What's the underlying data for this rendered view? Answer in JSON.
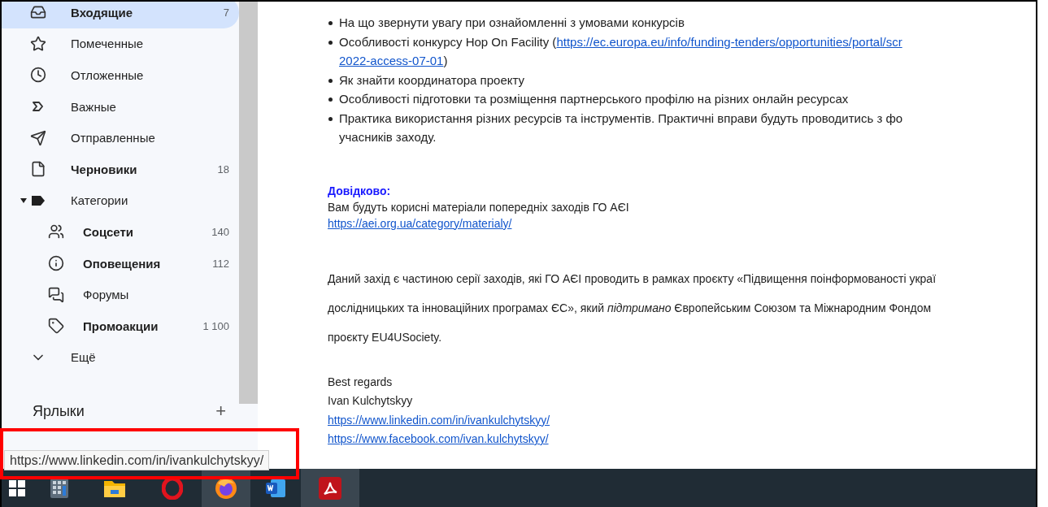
{
  "sidebar": {
    "items": [
      {
        "label": "Входящие",
        "count": "7",
        "selected": true,
        "unread": true
      },
      {
        "label": "Помеченные",
        "selected": false,
        "unread": false
      },
      {
        "label": "Отложенные",
        "selected": false,
        "unread": false
      },
      {
        "label": "Важные",
        "selected": false,
        "unread": false
      },
      {
        "label": "Отправленные",
        "selected": false,
        "unread": false
      },
      {
        "label": "Черновики",
        "count": "18",
        "selected": false,
        "unread": true
      },
      {
        "label": "Категории",
        "selected": false,
        "unread": false,
        "expanded": true,
        "children": [
          {
            "label": "Соцсети",
            "count": "140",
            "selected": false,
            "unread": true
          },
          {
            "label": "Оповещения",
            "count": "112",
            "selected": false,
            "unread": true
          },
          {
            "label": "Форумы",
            "selected": false,
            "unread": false
          },
          {
            "label": "Промоакции",
            "count": "1 100",
            "selected": false,
            "unread": true
          }
        ]
      },
      {
        "label": "Ещё",
        "selected": false,
        "unread": false
      }
    ],
    "labels_title": "Ярлыки",
    "add_button": "+"
  },
  "message": {
    "bullets": [
      {
        "lines": [
          {
            "text": "На що звернути увагу при ознайомленні з  умовами конкурсів"
          }
        ]
      },
      {
        "lines": [
          {
            "text": "Особливості конкурсу Hop On Facility (",
            "link": "https://ec.europa.eu/info/funding-tenders/opportunities/portal/scr"
          },
          {
            "link": "2022-access-07-01",
            "after": ")"
          }
        ]
      },
      {
        "lines": [
          {
            "text": "Як знайти координатора проекту"
          }
        ]
      },
      {
        "lines": [
          {
            "text": "Особливості підготовки та розміщення партнерського профілю на різних онлайн ресурсах"
          }
        ]
      },
      {
        "lines": [
          {
            "text": "Практика використання різних ресурсів та інструментів. Практичні вправи будуть проводитись з фо"
          },
          {
            "text": "учасників заходу."
          }
        ]
      }
    ],
    "reference": {
      "heading": "Довідково:",
      "text": "Вам будуть корисні матеріали попередніх заходів ГО АЄІ",
      "link": "https://aei.org.ua/category/materialy/"
    },
    "paragraph_lines": [
      "Даний захід   є частиною серії заходів, які ГО АЄІ проводить в рамках проєкту «Підвищення поінформованості украї",
      "дослідницьких та інноваційних програмах ЄС», який *підтримано*  Європейським Союзом  та Міжнародним Фондом",
      "проєкту EU4USociety."
    ],
    "signature": {
      "lines": [
        "Best regards",
        "Ivan Kulchytskyy"
      ],
      "links": [
        "https://www.linkedin.com/in/ivankulchytskyy/",
        "https://www.facebook.com/ivan.kulchytskyy/"
      ]
    }
  },
  "status_tooltip": "https://www.linkedin.com/in/ivankulchytskyy/",
  "taskbar": {
    "apps": [
      {
        "kind": "start",
        "active": false
      },
      {
        "kind": "calculator",
        "active": false
      },
      {
        "kind": "folder",
        "active": false
      },
      {
        "kind": "opera",
        "active": false
      },
      {
        "kind": "firefox",
        "active": true
      },
      {
        "kind": "word",
        "active": false
      },
      {
        "kind": "pdf",
        "active": true
      }
    ]
  }
}
